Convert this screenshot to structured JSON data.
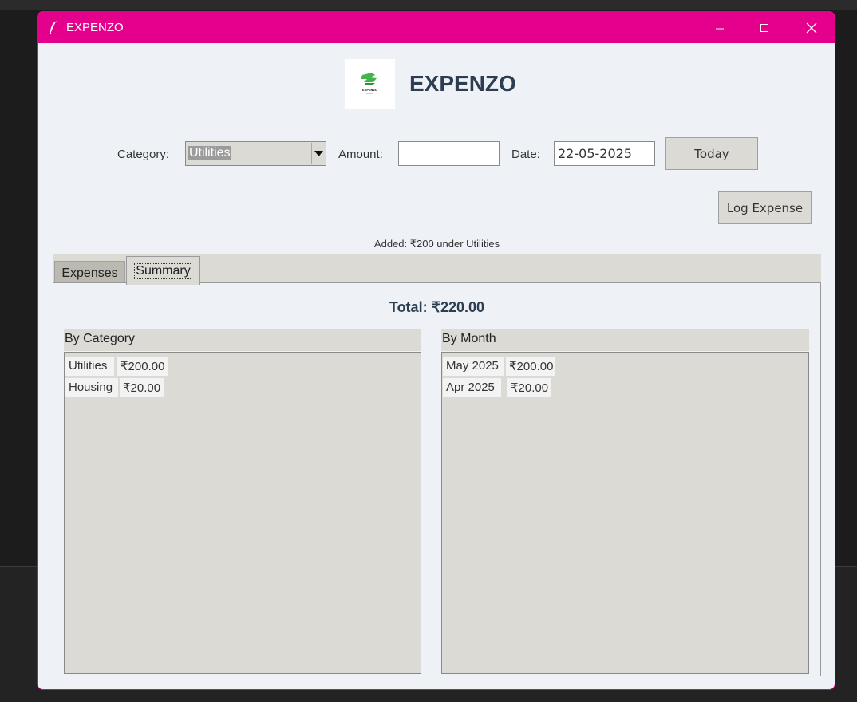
{
  "window": {
    "title": "EXPENZO"
  },
  "header": {
    "app_title": "EXPENZO",
    "logo_text": "EXPENZO"
  },
  "form": {
    "category_label": "Category:",
    "category_value": "Utilities",
    "amount_label": "Amount:",
    "amount_value": "",
    "date_label": "Date:",
    "date_value": "22-05-2025",
    "today_label": "Today",
    "log_label": "Log Expense"
  },
  "status": "Added: ₹200 under Utilities",
  "tabs": [
    {
      "label": "Expenses",
      "active": false
    },
    {
      "label": "Summary",
      "active": true
    }
  ],
  "summary": {
    "total": "Total: ₹220.00",
    "by_category": {
      "title": "By Category",
      "rows": [
        {
          "name": "Utilities",
          "amount": "₹200.00"
        },
        {
          "name": "Housing",
          "amount": "₹20.00"
        }
      ]
    },
    "by_month": {
      "title": "By Month",
      "rows": [
        {
          "name": "May 2025",
          "amount": "₹200.00"
        },
        {
          "name": "Apr 2025",
          "amount": "₹20.00"
        }
      ]
    }
  },
  "colors": {
    "titlebar": "#e4008c",
    "window_bg": "#eef2f7",
    "widget_bg": "#dcdad5",
    "heading": "#2c3e50"
  }
}
